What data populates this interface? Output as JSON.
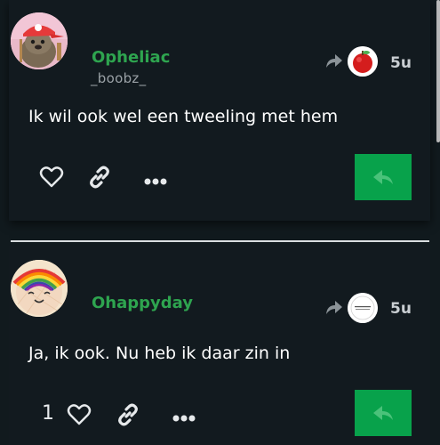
{
  "posts": [
    {
      "username": "Opheliac",
      "handle": "_boobz_",
      "time": "5u",
      "text": "Ik wil ook wel een tweeling met hem",
      "like_count": ""
    },
    {
      "username": "Ohappyday",
      "handle": "",
      "time": "5u",
      "text": "Ja, ik ook. Nu heb ik daar zin in",
      "like_count": "1"
    }
  ],
  "icons": {
    "like": "heart-icon",
    "link": "link-icon",
    "more": "more-dots-icon",
    "reply": "reply-arrow-icon",
    "reply_to": "reply-to-arrow-icon"
  },
  "colors": {
    "background": "#111a1e",
    "username": "#2ea44f",
    "reply_button": "#08a24b",
    "divider": "#d9dde0"
  }
}
